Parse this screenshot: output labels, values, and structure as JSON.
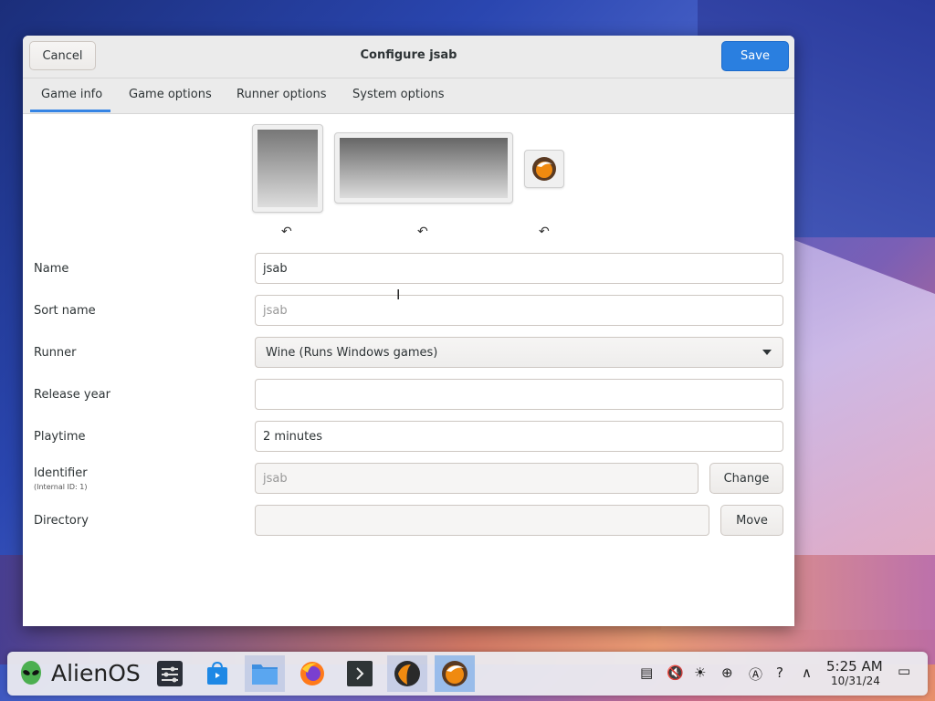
{
  "window": {
    "title": "Configure jsab",
    "cancel_label": "Cancel",
    "save_label": "Save"
  },
  "tabs": [
    {
      "label": "Game info",
      "active": true
    },
    {
      "label": "Game options",
      "active": false
    },
    {
      "label": "Runner options",
      "active": false
    },
    {
      "label": "System options",
      "active": false
    }
  ],
  "images": {
    "reset_glyph": "↶"
  },
  "form": {
    "name_label": "Name",
    "name_value": "jsab",
    "sort_name_label": "Sort name",
    "sort_name_placeholder": "jsab",
    "runner_label": "Runner",
    "runner_value": "Wine (Runs Windows games)",
    "release_year_label": "Release year",
    "release_year_value": "",
    "playtime_label": "Playtime",
    "playtime_value": "2 minutes",
    "identifier_label": "Identifier",
    "identifier_sublabel": "(Internal ID: 1)",
    "identifier_placeholder": "jsab",
    "change_label": "Change",
    "directory_label": "Directory",
    "directory_value": "",
    "move_label": "Move"
  },
  "taskbar": {
    "brand": "AlienOS",
    "apps": [
      "settings-icon",
      "store-icon",
      "files-icon",
      "firefox-icon",
      "terminal-icon",
      "lutris-icon",
      "lutris-game-icon"
    ],
    "clock_time": "5:25 AM",
    "clock_date": "10/31/24"
  },
  "colors": {
    "accent": "#3584e4",
    "save_button": "#2a7fe0"
  }
}
